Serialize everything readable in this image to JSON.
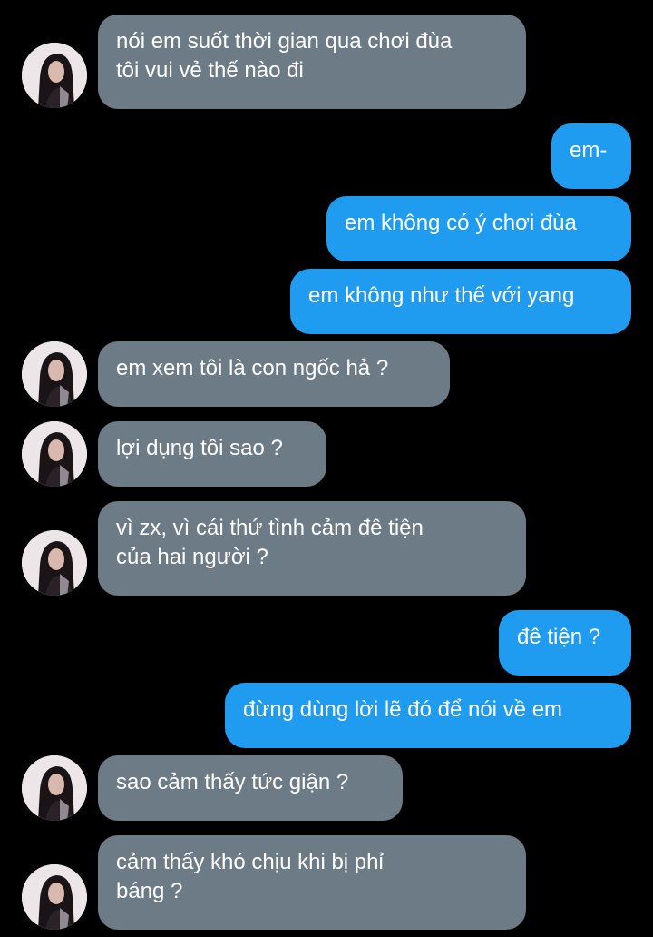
{
  "colors": {
    "background": "#000000",
    "incoming_bubble": "#6d7b86",
    "outgoing_bubble": "#1f9bf0",
    "text": "#ffffff"
  },
  "messages": [
    {
      "from": "them",
      "text": "nói em suốt thời gian qua chơi đùa\ntôi vui vẻ thế nào đi"
    },
    {
      "from": "me",
      "text": "em-"
    },
    {
      "from": "me",
      "text": "em không có ý chơi đùa"
    },
    {
      "from": "me",
      "text": "em không như thế với yang"
    },
    {
      "from": "them",
      "text": "em xem tôi là con ngốc hả ?"
    },
    {
      "from": "them",
      "text": "lợi dụng tôi sao ?"
    },
    {
      "from": "them",
      "text": "vì zx, vì cái thứ tình cảm đê tiện\ncủa hai người ?"
    },
    {
      "from": "me",
      "text": "đê tiện ?"
    },
    {
      "from": "me",
      "text": "đừng dùng lời lẽ đó để nói về em"
    },
    {
      "from": "them",
      "text": "sao cảm thấy tức giận ?"
    },
    {
      "from": "them",
      "text": "cảm thấy khó chịu khi bị phỉ\nbáng ?"
    }
  ],
  "avatar": {
    "icon": "profile-photo-girl-dark-hair"
  }
}
